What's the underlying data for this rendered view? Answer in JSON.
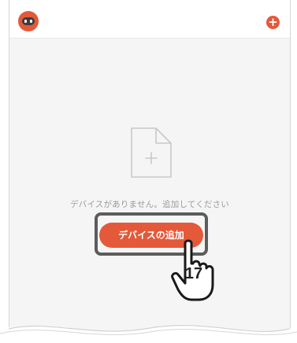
{
  "header": {
    "add_icon": "plus-circle-icon",
    "avatar_icon": "robot-avatar-icon"
  },
  "empty_state": {
    "icon": "add-file-icon",
    "message": "デバイスがありません。追加してください"
  },
  "primary_button": {
    "label": "デバイスの追加"
  },
  "callout": {
    "step_number": "17",
    "pointer_icon": "pointing-hand-icon"
  },
  "colors": {
    "accent": "#e3593a",
    "background": "#f5f5f5",
    "muted_text": "#9a9a9a",
    "highlight_border": "#5c5c5c"
  }
}
